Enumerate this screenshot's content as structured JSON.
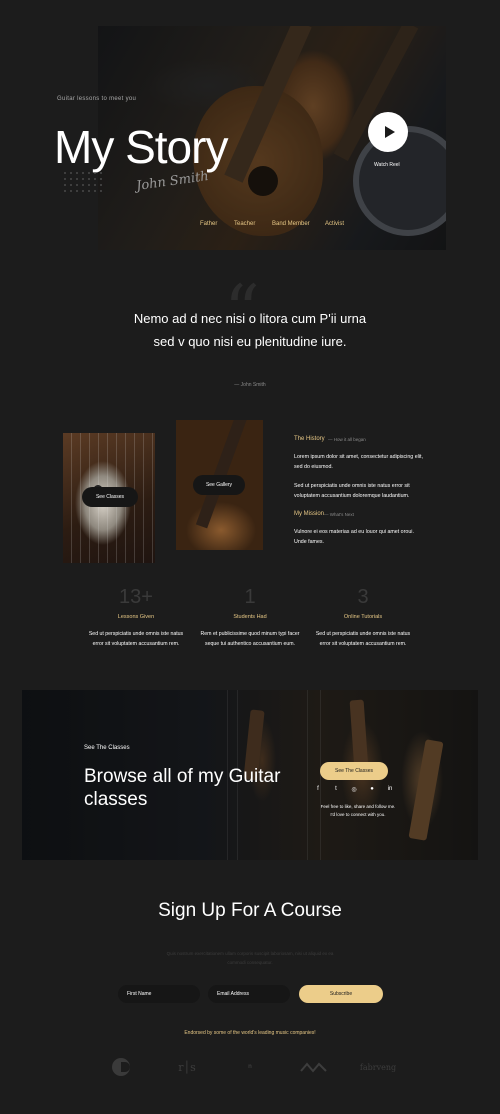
{
  "hero": {
    "kicker": "Guitar lessons to meet you",
    "title": "My Story",
    "signature": "John Smith",
    "watch_label": "Watch Reel",
    "tags": [
      "Father",
      "Teacher",
      "Band Member",
      "Activist"
    ]
  },
  "quote": {
    "mark": "“",
    "text": "Nemo ad d nec nisi o litora cum P'ii urna sed v quo nisi eu plenitudine iure.",
    "author": "— John Smith"
  },
  "history": {
    "see_classes": "See Classes",
    "see_gallery": "See Gallery",
    "history_label": "The History",
    "history_sub": "— How it all began",
    "history_p1": "Lorem ipsum dolor sit amet, consectetur adipiscing elit, sed do eiusmod.",
    "history_p2": "Sed ut perspiciatis unde omnis iste natus error sit voluptatem accusantium doloremque laudantium.",
    "mission_label": "My Mission",
    "mission_sub": "— What's Next",
    "mission_p": "Vulnore ei eos materias ad eu louor qui amet oroui. Unde fames."
  },
  "stats": [
    {
      "number": "13+",
      "label": "Lessons Given",
      "desc": "Sed ut perspiciatis unde omnis iste natus error sit voluptatem accusantium rem."
    },
    {
      "number": "1",
      "label": "Students Had",
      "desc": "Rem et publicissime quod minum typi facer seque tui authentico accusantium eum."
    },
    {
      "number": "3",
      "label": "Online Tutorials",
      "desc": "Sed ut perspiciatis unde omnis iste natus error sit voluptatem accusantium rem."
    }
  ],
  "banner": {
    "kicker": "See The Classes",
    "title": "Browse all of my Guitar classes",
    "button": "See The Classes",
    "social": [
      "facebook-icon",
      "twitter-icon",
      "instagram-icon",
      "spotify-icon",
      "linkedin-icon"
    ],
    "social_glyphs": [
      "f",
      "t",
      "◎",
      "●",
      "in"
    ],
    "note": "Feel free to like, share and follow me. I'd love to connect with you."
  },
  "signup": {
    "title": "Sign Up For A Course",
    "desc": "Quis nostrum exercitationem ullam corporis suscipit laboriosam, nisi ut aliquid ex ea commodi consequatur.",
    "first_name_placeholder": "First Name",
    "email_placeholder": "Email Address",
    "subscribe": "Subscribe",
    "endorse": "Endorsed by some of the world's leading music companies!",
    "logos": {
      "logo2": "r│s",
      "logo3": "n",
      "logo5": "fabrveng"
    }
  },
  "colors": {
    "accent": "#eccd8a",
    "background": "#1c1c1c",
    "tag_gold": "#e7c886"
  }
}
